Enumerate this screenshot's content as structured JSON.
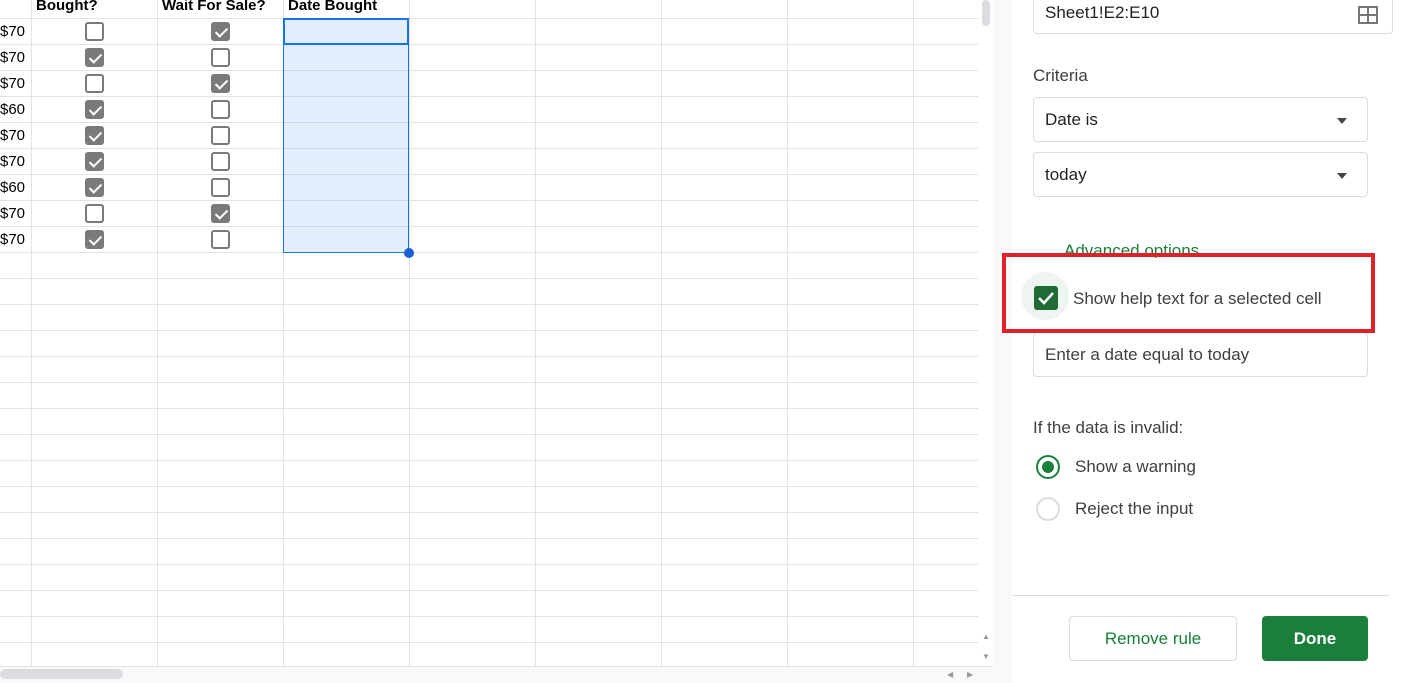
{
  "sheet": {
    "headers": {
      "bought": "Bought?",
      "wait": "Wait For Sale?",
      "date": "Date Bought"
    },
    "rows": [
      {
        "price": "$70",
        "bought": false,
        "wait": true
      },
      {
        "price": "$70",
        "bought": true,
        "wait": false
      },
      {
        "price": "$70",
        "bought": false,
        "wait": true
      },
      {
        "price": "$60",
        "bought": true,
        "wait": false
      },
      {
        "price": "$70",
        "bought": true,
        "wait": false
      },
      {
        "price": "$70",
        "bought": true,
        "wait": false
      },
      {
        "price": "$60",
        "bought": true,
        "wait": false
      },
      {
        "price": "$70",
        "bought": false,
        "wait": true
      },
      {
        "price": "$70",
        "bought": true,
        "wait": false
      }
    ]
  },
  "panel": {
    "range": "Sheet1!E2:E10",
    "range_icon": "grid-select-icon",
    "criteria_label": "Criteria",
    "criteria": "Date is",
    "criteria_value": "today",
    "advanced": "Advanced options",
    "help_checkbox": "Show help text for a selected cell",
    "help_checked": true,
    "help_text": "Enter a date equal to today",
    "invalid_label": "If the data is invalid:",
    "options": [
      {
        "label": "Show a warning",
        "selected": true
      },
      {
        "label": "Reject the input",
        "selected": false
      }
    ],
    "remove": "Remove rule",
    "done": "Done",
    "accent": "#188038",
    "highlight": "#e3202a"
  }
}
